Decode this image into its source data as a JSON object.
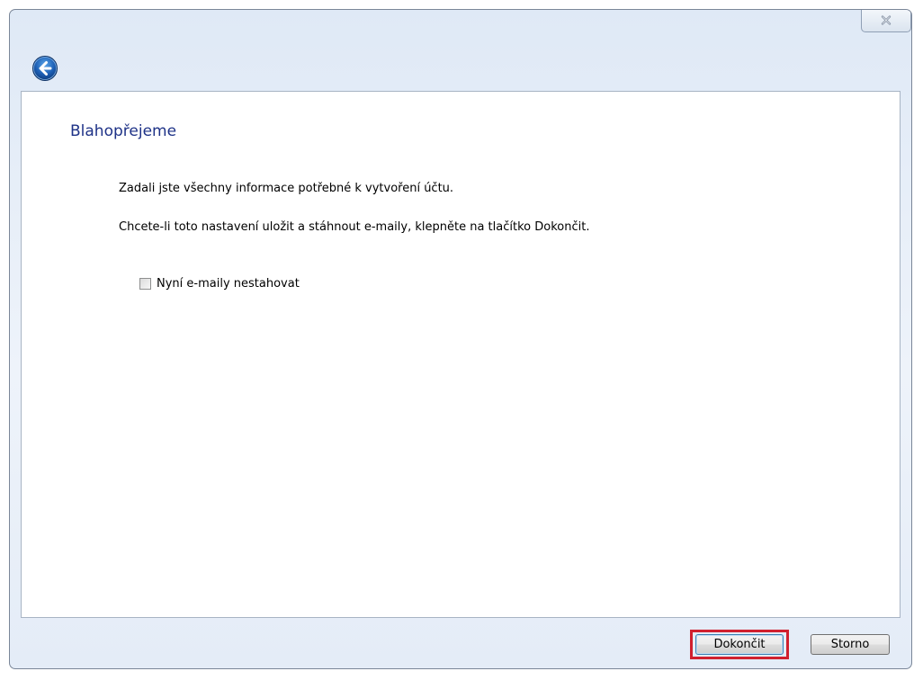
{
  "window": {
    "close_icon": "close-icon",
    "back_icon": "back-arrow-icon"
  },
  "content": {
    "title": "Blahopřejeme",
    "paragraph_1": "Zadali jste všechny informace potřebné k vytvoření účtu.",
    "paragraph_2": "Chcete-li toto nastavení uložit a stáhnout e-maily, klepněte na tlačítko Dokončit.",
    "checkbox": {
      "label": "Nyní e-maily nestahovat",
      "checked": false
    }
  },
  "footer": {
    "finish_label": "Dokončit",
    "cancel_label": "Storno",
    "highlight_color": "#d0202e"
  },
  "colors": {
    "title": "#1e3287",
    "accent": "#3c7fb1"
  }
}
